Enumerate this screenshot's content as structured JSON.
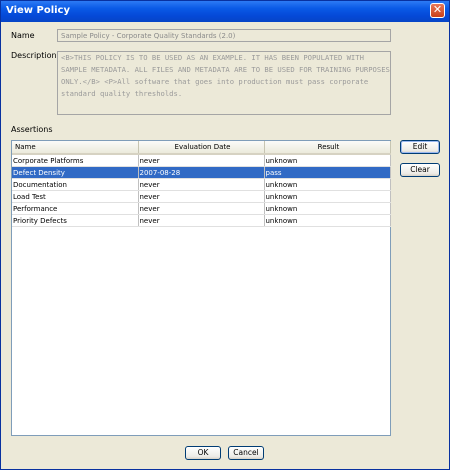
{
  "window": {
    "title": "View Policy"
  },
  "form": {
    "name_label": "Name",
    "name_value": "Sample Policy - Corporate Quality Standards (2.0)",
    "description_label": "Description",
    "description_value": "<B>THIS POLICY IS TO BE USED AS AN EXAMPLE. IT HAS BEEN POPULATED WITH SAMPLE METADATA. ALL FILES AND METADATA ARE TO BE USED FOR TRAINING PURPOSES ONLY.</B> <P>All software that goes into production must pass corporate standard quality thresholds.",
    "assertions_label": "Assertions"
  },
  "assertions": {
    "columns": [
      "Name",
      "Evaluation Date",
      "Result"
    ],
    "rows": [
      {
        "name": "Corporate Platforms",
        "date": "never",
        "result": "unknown",
        "selected": false
      },
      {
        "name": "Defect Density",
        "date": "2007-08-28",
        "result": "pass",
        "selected": true
      },
      {
        "name": "Documentation",
        "date": "never",
        "result": "unknown",
        "selected": false
      },
      {
        "name": "Load Test",
        "date": "never",
        "result": "unknown",
        "selected": false
      },
      {
        "name": "Performance",
        "date": "never",
        "result": "unknown",
        "selected": false
      },
      {
        "name": "Priority Defects",
        "date": "never",
        "result": "unknown",
        "selected": false
      }
    ]
  },
  "buttons": {
    "edit": "Edit",
    "clear": "Clear",
    "ok": "OK",
    "cancel": "Cancel",
    "close": "✕"
  },
  "colors": {
    "titlebar": "#0549d8",
    "selection": "#316ac5",
    "background": "#ece9d8"
  }
}
